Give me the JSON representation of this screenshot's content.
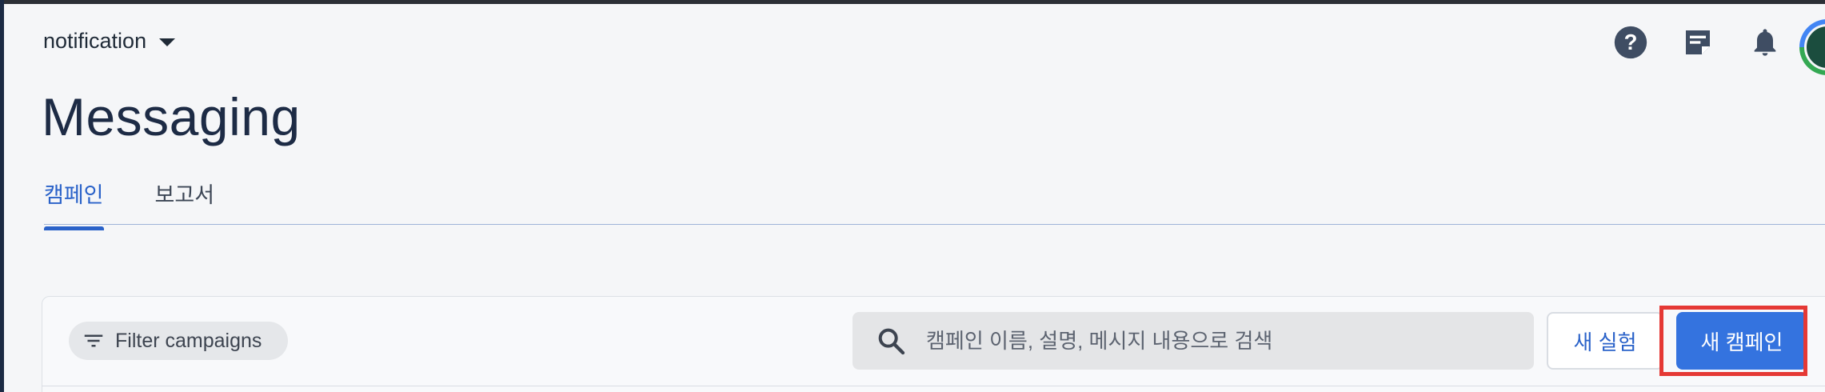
{
  "header": {
    "project_name": "notification",
    "icons": [
      "help-icon",
      "feedback-icon",
      "notifications-icon"
    ],
    "avatar": "user-avatar"
  },
  "page": {
    "title": "Messaging"
  },
  "tabs": [
    {
      "label": "캠페인",
      "active": true
    },
    {
      "label": "보고서",
      "active": false
    }
  ],
  "toolbar": {
    "filter_label": "Filter campaigns",
    "search_placeholder": "캠페인 이름, 설명, 메시지 내용으로 검색",
    "new_experiment_label": "새 실험",
    "new_campaign_label": "새 캠페인"
  },
  "colors": {
    "accent": "#2a62c9",
    "primary_button": "#3473df",
    "highlight": "#e53935",
    "title": "#1d2b45"
  }
}
